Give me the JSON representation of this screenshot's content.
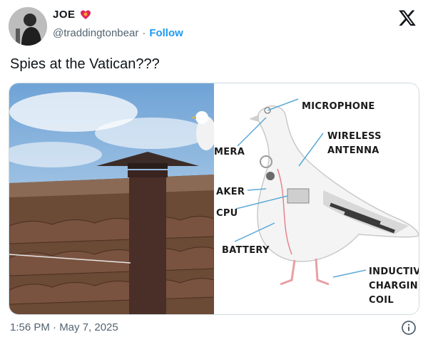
{
  "author": {
    "display_name": "JOE",
    "handle": "@traddingtonbear",
    "separator": "·",
    "follow_label": "Follow"
  },
  "tweet": {
    "text": "Spies at the Vatican???",
    "timestamp": "1:56 PM · May 7, 2025"
  },
  "media": {
    "diagram_labels": {
      "microphone": "MICROPHONE",
      "wireless_line1": "WIRELESS",
      "wireless_line2": "ANTENNA",
      "camera": "MERA",
      "speaker": "AKER",
      "cpu": "CPU",
      "battery": "BATTERY",
      "inductive_line1": "INDUCTIV",
      "inductive_line2": "CHARGIN",
      "inductive_line3": "COIL"
    }
  },
  "icons": {
    "heart": "heart-icon",
    "x_logo": "x-logo-icon",
    "info": "info-icon"
  },
  "colors": {
    "link": "#1d9bf0",
    "secondary_text": "#536471",
    "diagram_lines": "#5aa9d6"
  }
}
